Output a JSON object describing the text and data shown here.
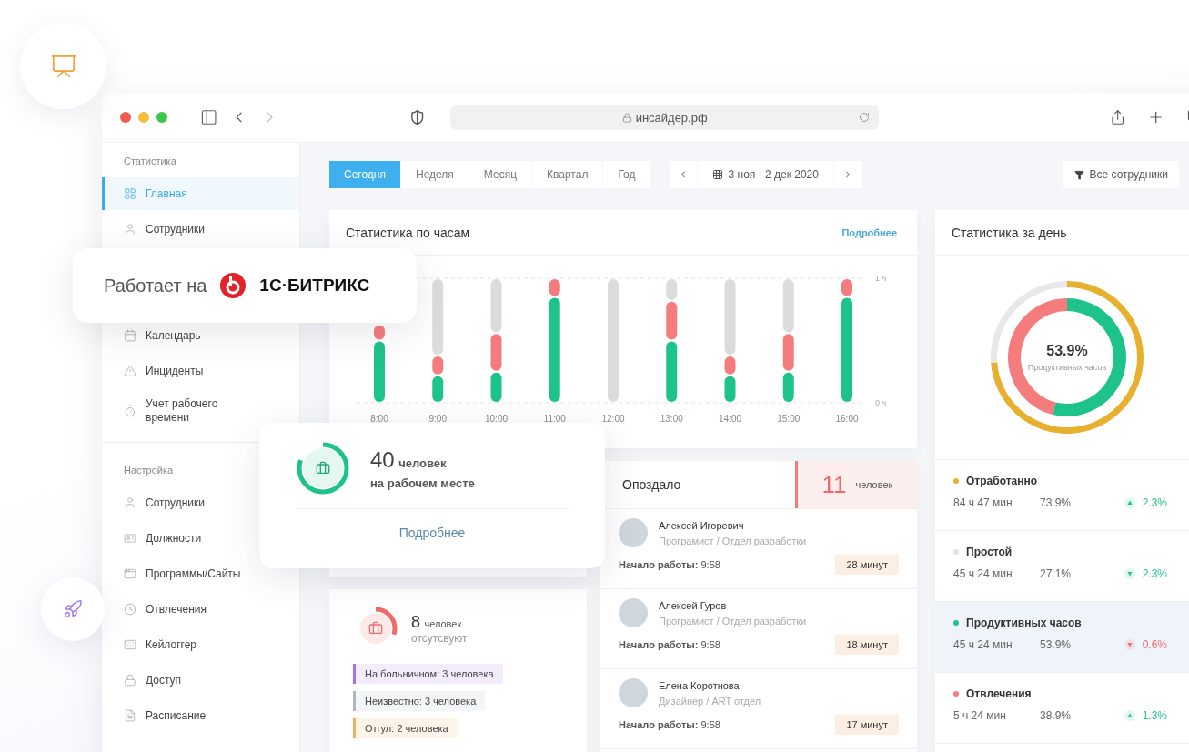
{
  "browser": {
    "url": "инсайдер.рф"
  },
  "sidebar": {
    "sections": [
      {
        "title": "Статистика",
        "items": [
          {
            "label": "Главная",
            "selected": true
          },
          {
            "label": "Сотрудники",
            "selected": false
          },
          {
            "label": "Календарь",
            "selected": false
          },
          {
            "label": "Инциденты",
            "selected": false
          },
          {
            "label": "Учет рабочего времени",
            "selected": false
          }
        ]
      },
      {
        "title": "Настройка",
        "items": [
          {
            "label": "Сотрудники",
            "selected": false
          },
          {
            "label": "Должности",
            "selected": false
          },
          {
            "label": "Программы/Сайты",
            "selected": false
          },
          {
            "label": "Отвлечения",
            "selected": false
          },
          {
            "label": "Кейлоггер",
            "selected": false
          },
          {
            "label": "Доступ",
            "selected": false
          },
          {
            "label": "Расписание",
            "selected": false
          }
        ]
      }
    ]
  },
  "periods": [
    {
      "label": "Сегодня",
      "selected": true
    },
    {
      "label": "Неделя",
      "selected": false
    },
    {
      "label": "Месяц",
      "selected": false
    },
    {
      "label": "Квартал",
      "selected": false
    },
    {
      "label": "Год",
      "selected": false
    }
  ],
  "date_range": "3 ноя - 2 дек 2020",
  "filter": "Все сотрудники",
  "hourly": {
    "title": "Статистика по часам",
    "more": "Подробнее",
    "chart_data": {
      "type": "bar",
      "stacked": true,
      "categories": [
        "8:00",
        "9:00",
        "10:00",
        "11:00",
        "12:00",
        "13:00",
        "14:00",
        "15:00",
        "16:00"
      ],
      "series": [
        {
          "color": "#1ec28b",
          "values": [
            0.5,
            0.22,
            0.25,
            0.85,
            0,
            0.5,
            0.22,
            0.25,
            0.85
          ]
        },
        {
          "color": "#f47c7c",
          "values": [
            0.13,
            0.16,
            0.31,
            0.15,
            0,
            0.32,
            0.16,
            0.31,
            0.15
          ]
        },
        {
          "color": "#dcdcdc",
          "values": [
            0,
            0.62,
            0.44,
            0,
            1,
            0.18,
            0.62,
            0.44,
            0
          ]
        }
      ],
      "ylim": [
        0,
        1
      ],
      "yticks": [
        {
          "value": 0,
          "label": "0 ч"
        },
        {
          "value": 1,
          "label": "1 ч"
        }
      ]
    }
  },
  "day": {
    "title": "Статистика за день",
    "center_value": "53.9%",
    "center_label": "Продуктивных часов",
    "rows": [
      {
        "name": "Отработанно",
        "color": "#e8b02f",
        "time": "84 ч 47 мин",
        "percent": "73.9%",
        "change": "2.3%",
        "kind": "rise",
        "selected": false
      },
      {
        "name": "Простой",
        "color": "#e4e4e4",
        "time": "45 ч 24 мин",
        "percent": "27.1%",
        "change": "2.3%",
        "kind": "dip",
        "selected": false
      },
      {
        "name": "Продуктивных часов",
        "color": "#1ec28b",
        "time": "45 ч 24 мин",
        "percent": "53.9%",
        "change": "0.6%",
        "kind": "drop",
        "selected": true
      },
      {
        "name": "Отвлечения",
        "color": "#f47c7c",
        "time": "5 ч 24 мин",
        "percent": "38.9%",
        "change": "1.3%",
        "kind": "rise",
        "selected": false
      }
    ]
  },
  "late": {
    "title": "Опоздало",
    "count": "11",
    "unit": "человек",
    "people": [
      {
        "name": "Алексей Игоревич",
        "role": "Програмист / Отдел разработки",
        "start": "**Начало работы:** 9:58",
        "delay": "28 минут"
      },
      {
        "name": "Алексей Гуров",
        "role": "Програмист / Отдел разработки",
        "start": "**Начало работы:** 9:58",
        "delay": "18 минут"
      },
      {
        "name": "Елена Коротнова",
        "role": "Дизайнер / ART отдел",
        "start": "**Начало работы:** 9:58",
        "delay": "17 минут"
      }
    ]
  },
  "absent": {
    "count": "8",
    "unit": "человек",
    "label": "отсутсвуют",
    "level": 0.3,
    "reasons": [
      {
        "text": "На больничном: 3 человека",
        "color": "#a56ff0"
      },
      {
        "text": "Неизвестно: 3 человека",
        "color": "#b0b6c0"
      },
      {
        "text": "Отгул: 2 человека",
        "color": "#f0b060"
      }
    ]
  },
  "present": {
    "count": "40",
    "unit": "человек",
    "label": "на рабочем месте",
    "more": "Подробнее",
    "level": 0.8
  },
  "powered": {
    "label": "Работает на",
    "brand": "1С·БИТРИКС"
  }
}
